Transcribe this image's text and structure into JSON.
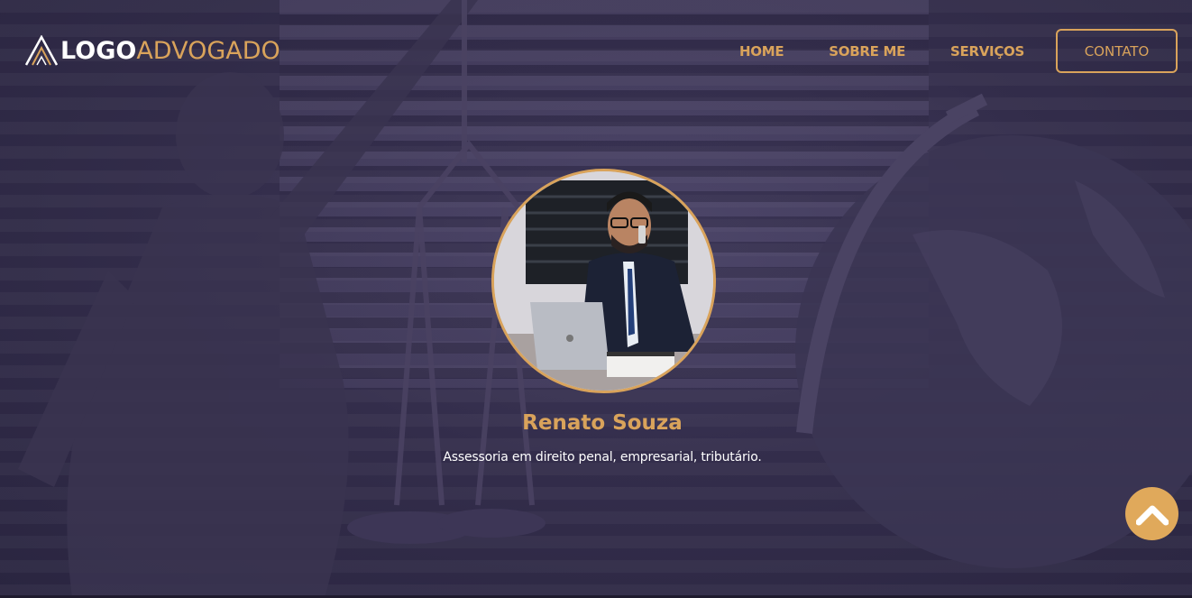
{
  "logo": {
    "text_bold": "LOGO",
    "text_light": "ADVOGADO",
    "icon": "triangle-logo-icon"
  },
  "nav": {
    "items": [
      {
        "label": "HOME"
      },
      {
        "label": "SOBRE ME"
      },
      {
        "label": "SERVIÇOS"
      }
    ],
    "contact_label": "CONTATO"
  },
  "profile": {
    "name": "Renato Souza",
    "tagline": "Assessoria em direito penal, empresarial, tributário.",
    "photo": "lawyer-on-phone-photo"
  },
  "scroll_top": {
    "icon": "chevron-up-icon"
  },
  "colors": {
    "accent": "#d9a35b",
    "background": "#2f2a45",
    "text": "#ffffff"
  }
}
